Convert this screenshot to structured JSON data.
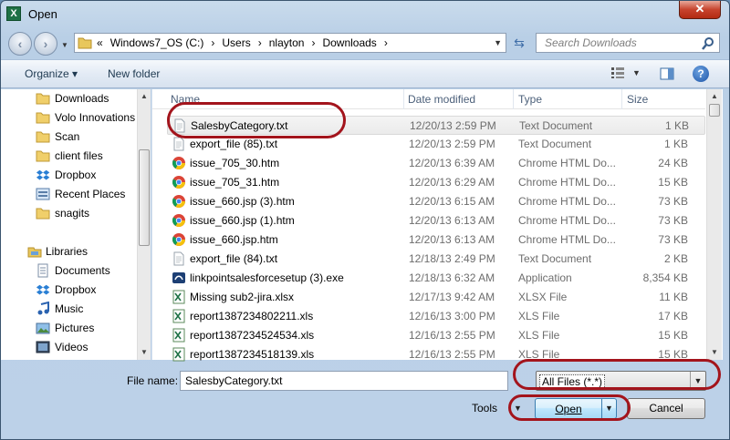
{
  "window": {
    "title": "Open",
    "app_icon": "excel-icon",
    "close_label": "✕"
  },
  "address": {
    "segments": [
      "«",
      "Windows7_OS (C:)",
      "›",
      "Users",
      "›",
      "nlayton",
      "›",
      "Downloads",
      "›"
    ]
  },
  "search": {
    "placeholder": "Search Downloads"
  },
  "toolbar": {
    "organize": "Organize ▾",
    "new_folder": "New folder"
  },
  "nav": {
    "favorites": [
      {
        "label": "Downloads",
        "icon": "folder-icon"
      },
      {
        "label": "Volo Innovations",
        "icon": "folder-icon"
      },
      {
        "label": "Scan",
        "icon": "folder-icon"
      },
      {
        "label": "client files",
        "icon": "folder-icon"
      },
      {
        "label": "Dropbox",
        "icon": "dropbox-icon"
      },
      {
        "label": "Recent Places",
        "icon": "recent-places-icon"
      },
      {
        "label": "snagits",
        "icon": "folder-icon"
      }
    ],
    "libraries": [
      {
        "label": "Libraries",
        "icon": "libraries-icon"
      },
      {
        "label": "Documents",
        "icon": "documents-icon"
      },
      {
        "label": "Dropbox",
        "icon": "dropbox-icon"
      },
      {
        "label": "Music",
        "icon": "music-icon"
      },
      {
        "label": "Pictures",
        "icon": "pictures-icon"
      },
      {
        "label": "Videos",
        "icon": "videos-icon"
      }
    ]
  },
  "columns": [
    "Name",
    "Date modified",
    "Type",
    "Size"
  ],
  "files": [
    {
      "name": "SalesbyCategory.txt",
      "date": "12/20/13 2:59 PM",
      "type": "Text Document",
      "size": "1 KB",
      "icon": "text-file-icon"
    },
    {
      "name": "export_file (85).txt",
      "date": "12/20/13 2:59 PM",
      "type": "Text Document",
      "size": "1 KB",
      "icon": "text-file-icon"
    },
    {
      "name": "issue_705_30.htm",
      "date": "12/20/13 6:39 AM",
      "type": "Chrome HTML Do...",
      "size": "24 KB",
      "icon": "chrome-icon"
    },
    {
      "name": "issue_705_31.htm",
      "date": "12/20/13 6:29 AM",
      "type": "Chrome HTML Do...",
      "size": "15 KB",
      "icon": "chrome-icon"
    },
    {
      "name": "issue_660.jsp (3).htm",
      "date": "12/20/13 6:15 AM",
      "type": "Chrome HTML Do...",
      "size": "73 KB",
      "icon": "chrome-icon"
    },
    {
      "name": "issue_660.jsp (1).htm",
      "date": "12/20/13 6:13 AM",
      "type": "Chrome HTML Do...",
      "size": "73 KB",
      "icon": "chrome-icon"
    },
    {
      "name": "issue_660.jsp.htm",
      "date": "12/20/13 6:13 AM",
      "type": "Chrome HTML Do...",
      "size": "73 KB",
      "icon": "chrome-icon"
    },
    {
      "name": "export_file (84).txt",
      "date": "12/18/13 2:49 PM",
      "type": "Text Document",
      "size": "2 KB",
      "icon": "text-file-icon"
    },
    {
      "name": "linkpointsalesforcesetup (3).exe",
      "date": "12/18/13 6:32 AM",
      "type": "Application",
      "size": "8,354 KB",
      "icon": "application-icon"
    },
    {
      "name": "Missing sub2-jira.xlsx",
      "date": "12/17/13 9:42 AM",
      "type": "XLSX File",
      "size": "11 KB",
      "icon": "spreadsheet-icon"
    },
    {
      "name": "report1387234802211.xls",
      "date": "12/16/13 3:00 PM",
      "type": "XLS File",
      "size": "17 KB",
      "icon": "spreadsheet-icon"
    },
    {
      "name": "report1387234524534.xls",
      "date": "12/16/13 2:55 PM",
      "type": "XLS File",
      "size": "15 KB",
      "icon": "spreadsheet-icon"
    },
    {
      "name": "report1387234518139.xls",
      "date": "12/16/13 2:55 PM",
      "type": "XLS File",
      "size": "15 KB",
      "icon": "spreadsheet-icon"
    }
  ],
  "filename": {
    "label": "File name:",
    "value": "SalesbyCategory.txt"
  },
  "filter": {
    "value": "All Files (*.*)"
  },
  "actions": {
    "tools": "Tools",
    "open": "Open",
    "cancel": "Cancel"
  },
  "colors": {
    "annotation": "#a3141c",
    "selection_row": "#ebebeb",
    "open_button": "#bee6fd"
  }
}
